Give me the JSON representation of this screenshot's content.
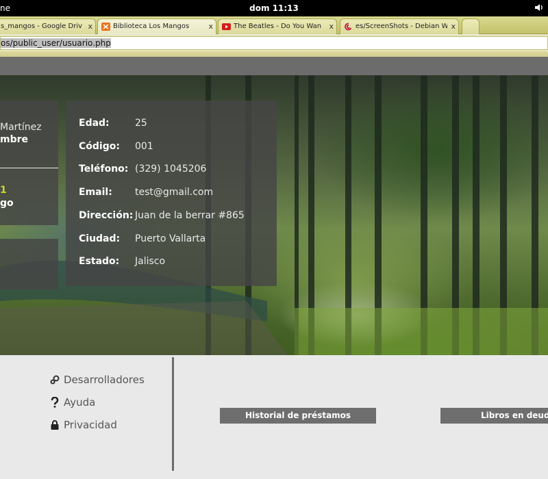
{
  "system": {
    "app_partial": "ne",
    "clock": "dom 11:13",
    "volume_icon": "speaker-icon"
  },
  "tabs": [
    {
      "title": "s_mangos - Google Driv",
      "icon": "google-drive-icon",
      "close": "x",
      "active": false
    },
    {
      "title": "Biblioteca Los Mangos",
      "icon": "orange-site-icon",
      "close": "x",
      "active": true
    },
    {
      "title": "The Beatles - Do You Wan",
      "icon": "youtube-icon",
      "close": "x",
      "active": false
    },
    {
      "title": "es/ScreenShots - Debian W",
      "icon": "debian-swirl-icon",
      "close": "x",
      "active": false
    }
  ],
  "address_bar": {
    "url": "os/public_user/usuario.php"
  },
  "profile_clip": {
    "name_partial": "Martínez",
    "name_partial_2": "mbre",
    "code_partial": "1",
    "label_partial": "go"
  },
  "user_details": [
    {
      "label": "Edad:",
      "value": "25"
    },
    {
      "label": "Código:",
      "value": "001"
    },
    {
      "label": "Teléfono:",
      "value": "(329) 1045206"
    },
    {
      "label": "Email:",
      "value": "test@gmail.com"
    },
    {
      "label": "Dirección:",
      "value": "Juan de la berrar #865"
    },
    {
      "label": "Ciudad:",
      "value": "Puerto Vallarta"
    },
    {
      "label": "Estado:",
      "value": "Jalisco"
    }
  ],
  "footer": {
    "links": [
      {
        "label": "Desarrolladores",
        "icon": "gears-icon"
      },
      {
        "label": "Ayuda",
        "icon": "question-icon"
      },
      {
        "label": "Privacidad",
        "icon": "lock-icon"
      }
    ],
    "buttons": [
      {
        "label": "Historial de préstamos"
      },
      {
        "label": "Libros en deud"
      }
    ]
  }
}
